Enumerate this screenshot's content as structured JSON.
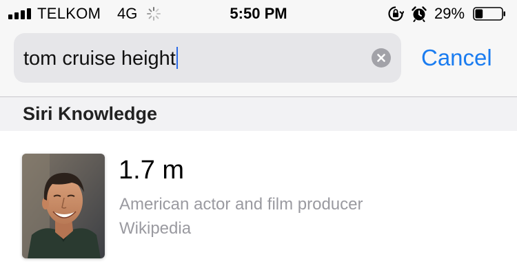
{
  "status_bar": {
    "carrier": "TELKOM",
    "network": "4G",
    "time": "5:50 PM",
    "battery_percent": "29%",
    "battery_level": 0.29,
    "icons": [
      "signal-icon",
      "loading-spinner-icon",
      "rotation-lock-icon",
      "alarm-icon",
      "battery-icon"
    ]
  },
  "search": {
    "query": "tom cruise height",
    "cancel_label": "Cancel"
  },
  "section": {
    "title": "Siri Knowledge"
  },
  "result": {
    "value": "1.7 m",
    "description": "American actor and film producer",
    "source": "Wikipedia"
  },
  "colors": {
    "accent": "#1a7cf0",
    "secondary_text": "#9a9aa0",
    "field_background": "#e6e6e9"
  }
}
